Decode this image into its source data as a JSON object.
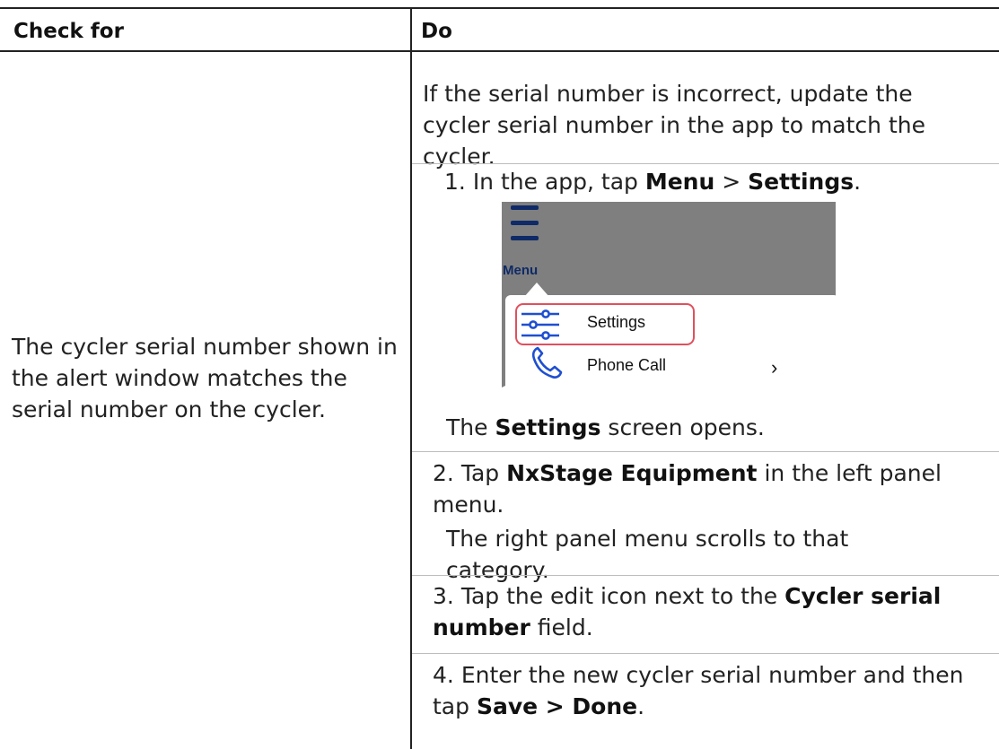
{
  "table": {
    "headers": {
      "check_for": "Check for",
      "do": "Do"
    },
    "check_text": "The cycler serial number shown in the alert window matches the serial number on the cycler.",
    "intro": "If the serial number is incorrect, update the cycler serial number in the app to match the cycler.",
    "steps": [
      {
        "num": "1.",
        "pre": "In the app, tap ",
        "b1": "Menu",
        "mid": " > ",
        "b2": "Settings",
        "post": "."
      },
      {
        "num": "2.",
        "pre": "Tap ",
        "b1": "NxStage Equipment",
        "post": " in the left panel menu."
      },
      {
        "num": "3.",
        "pre": "Tap the edit icon next to the ",
        "b1": "Cycler serial number",
        "post": " field."
      },
      {
        "num": "4.",
        "pre": "Enter the new cycler serial number and then tap ",
        "b1": "Save > Done",
        "post": "."
      }
    ],
    "result1": {
      "pre": "The ",
      "b": "Settings",
      "post": " screen opens."
    },
    "result2": "The right panel menu scrolls to that category."
  },
  "screenshot": {
    "menu_label": "Menu",
    "items": [
      {
        "label": "Settings",
        "icon": "sliders-icon"
      },
      {
        "label": "Phone Call",
        "icon": "phone-icon",
        "chevron": "›"
      }
    ],
    "colors": {
      "icon_blue": "#1f4fd1",
      "menu_navy": "#0f2a66",
      "highlight": "#e0505e",
      "backdrop": "#7f7f7f"
    }
  }
}
